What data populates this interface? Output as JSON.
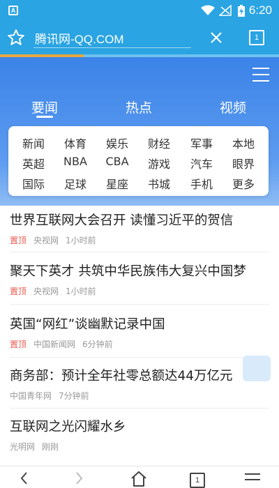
{
  "status_bar": {
    "app_badge": "A",
    "time": "6:20",
    "icons": [
      "wifi-icon",
      "no-signal-icon",
      "battery-charging-icon"
    ]
  },
  "url_bar": {
    "url_text": "腾讯网-QQ.COM",
    "tab_count": "1",
    "icons": [
      "star-icon",
      "close-icon"
    ]
  },
  "page_load_progress": 0.3,
  "news_tabs": [
    {
      "label": "要闻",
      "selected": true
    },
    {
      "label": "热点",
      "selected": false
    },
    {
      "label": "视频",
      "selected": false
    }
  ],
  "categories": [
    [
      "新闻",
      "体育",
      "娱乐",
      "财经",
      "军事",
      "本地"
    ],
    [
      "英超",
      "NBA",
      "CBA",
      "游戏",
      "汽车",
      "眼界"
    ],
    [
      "国际",
      "足球",
      "星座",
      "书城",
      "手机",
      "更多"
    ]
  ],
  "news": [
    {
      "title": "世界互联网大会召开 读懂习近平的贺信",
      "pin": "置顶",
      "source": "央视网",
      "time": "1小时前"
    },
    {
      "title": "聚天下英才 共筑中华民族伟大复兴中国梦",
      "pin": "置顶",
      "source": "央视网",
      "time": "1小时前"
    },
    {
      "title": "英国“网红”谈幽默记录中国",
      "pin": "置顶",
      "source": "中国新闻网",
      "time": "6分钟前"
    },
    {
      "title": "商务部：预计全年社零总额达44万亿元",
      "pin": "",
      "source": "中国青年网",
      "time": "7分钟前"
    },
    {
      "title": "互联网之光闪耀水乡",
      "pin": "",
      "source": "光明网",
      "time": "刚刚"
    }
  ],
  "bottom_bar": {
    "tab_count": "1",
    "icons": [
      "back-icon",
      "forward-icon",
      "home-icon",
      "tabs-icon",
      "menu-icon"
    ]
  },
  "colors": {
    "top_bar": "#2aa4e2",
    "hero_blue": "#3b83e8",
    "pin_red": "#e85a4f",
    "progress": "#e6a83c"
  }
}
